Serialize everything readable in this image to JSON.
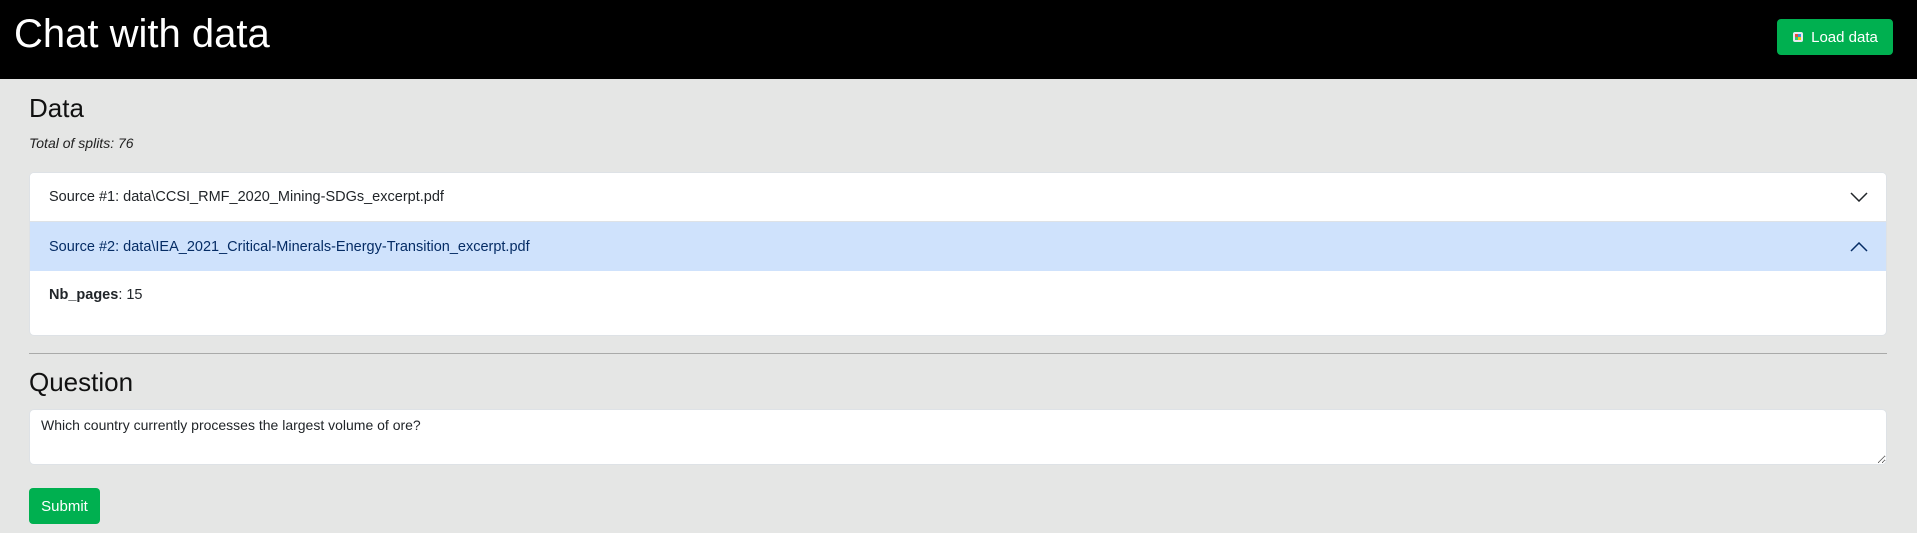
{
  "header": {
    "title": "Chat with data",
    "load_button": {
      "label": "Load data",
      "icon": "database-icon"
    }
  },
  "data_section": {
    "title": "Data",
    "total_splits": "Total of splits: 76",
    "sources": [
      {
        "label": "Source #1: data\\CCSI_RMF_2020_Mining-SDGs_excerpt.pdf",
        "expanded": false,
        "icon": "chevron-down-icon"
      },
      {
        "label": "Source #2: data\\IEA_2021_Critical-Minerals-Energy-Transition_excerpt.pdf",
        "expanded": true,
        "icon": "chevron-up-icon"
      }
    ],
    "expanded_detail": {
      "key": "Nb_pages",
      "value": ": 15"
    }
  },
  "question_section": {
    "title": "Question",
    "input_value": "Which country currently processes the largest volume of ore?",
    "submit_label": "Submit"
  },
  "colors": {
    "accent_green": "#00b050",
    "header_bg": "#000000",
    "page_bg": "#e5e6e5",
    "expanded_bg": "#cfe2fc"
  }
}
